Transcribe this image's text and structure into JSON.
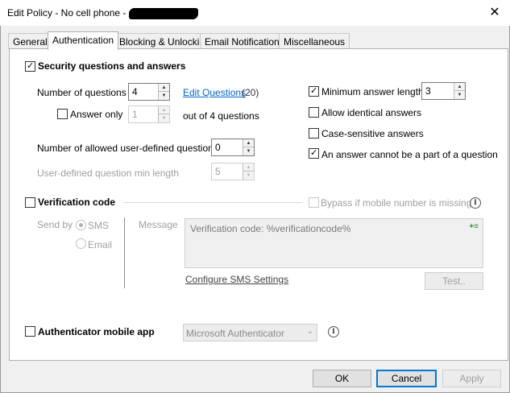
{
  "window": {
    "title": "Edit Policy - No cell phone - ",
    "close_glyph": "✕"
  },
  "tabs": [
    {
      "label": "General"
    },
    {
      "label": "Authentication"
    },
    {
      "label": "Blocking & Unlocking"
    },
    {
      "label": "Email Notifications"
    },
    {
      "label": "Miscellaneous"
    }
  ],
  "security": {
    "checkbox_label": "Security questions and answers",
    "checked": true,
    "num_questions_label": "Number of questions",
    "num_questions_value": "4",
    "edit_questions_link": "Edit Questions",
    "edit_questions_count": "(20)",
    "answer_only_label": "Answer only",
    "answer_only_value": "1",
    "out_of_label": "out of 4 questions",
    "allowed_user_defined_label": "Number of allowed user-defined questions",
    "allowed_user_defined_value": "0",
    "user_defined_min_label": "User-defined question min length",
    "user_defined_min_value": "5",
    "min_answer_length_label": "Minimum answer length",
    "min_answer_length_value": "3",
    "allow_identical_label": "Allow identical answers",
    "case_sensitive_label": "Case-sensitive answers",
    "answer_not_part_label": "An answer cannot be a part of a question"
  },
  "verification": {
    "checkbox_label": "Verification code",
    "bypass_label": "Bypass if mobile number is missing",
    "send_by_label": "Send by",
    "sms_label": "SMS",
    "email_label": "Email",
    "message_label": "Message",
    "message_value": "Verification code: %verificationcode%",
    "configure_link": "Configure SMS Settings",
    "test_button": "Test.."
  },
  "authenticator": {
    "checkbox_label": "Authenticator mobile app",
    "select_value": "Microsoft Authenticator"
  },
  "footer": {
    "ok": "OK",
    "cancel": "Cancel",
    "apply": "Apply"
  },
  "icons": {
    "check": "✓",
    "spin_up": "▲",
    "spin_down": "▼",
    "dropdown": "⌄",
    "info": "i",
    "insert_variable": "+≡"
  },
  "colors": {
    "accent": "#0078d7",
    "link": "#0066cc"
  }
}
